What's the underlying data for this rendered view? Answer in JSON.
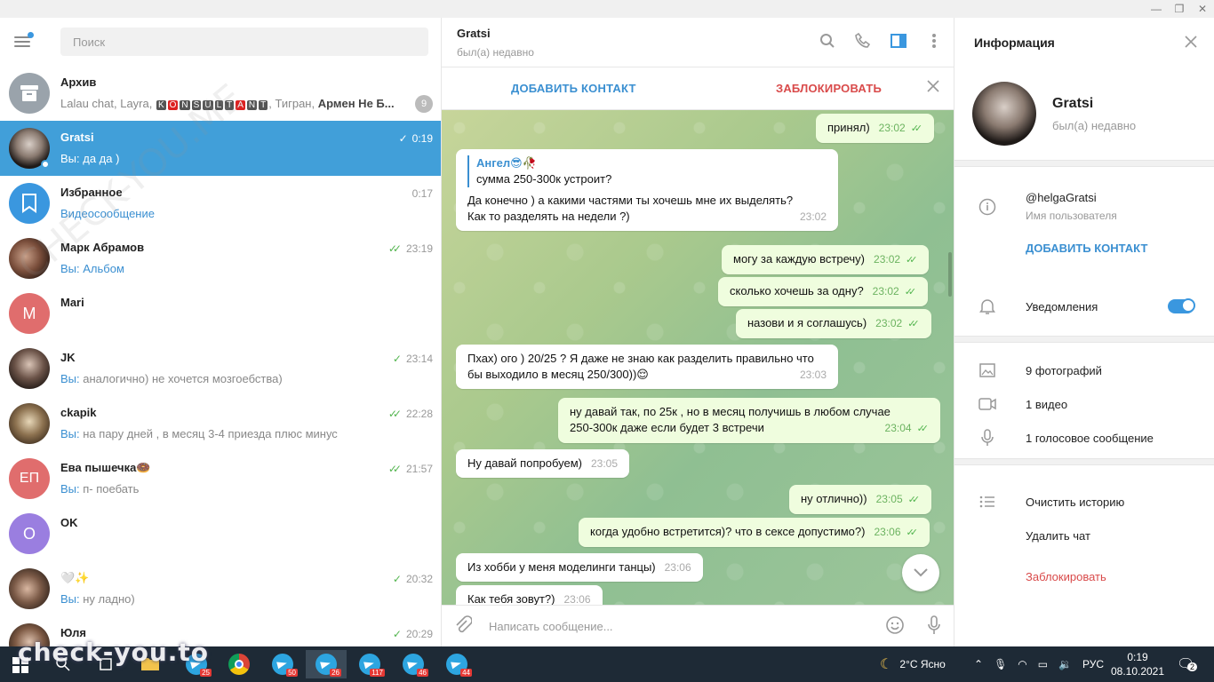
{
  "window": {
    "min": "—",
    "max": "❐",
    "close": "✕"
  },
  "left": {
    "search_placeholder": "Поиск",
    "chats": [
      {
        "name": "Архив",
        "preview": "Lalau chat, Layra, ",
        "preview_tail": ", Тигран, ",
        "preview_bold": "Армен Не Б...",
        "badge": "9",
        "konsult": [
          "K",
          "O",
          "N",
          "S",
          "U",
          "L",
          "T",
          "A",
          "N",
          "T"
        ]
      },
      {
        "name": "Gratsi",
        "you": "Вы:",
        "preview": " да да )",
        "time": "0:19"
      },
      {
        "name": "Избранное",
        "preview": "Видеосообщение",
        "time": "0:17"
      },
      {
        "name": "Марк Абрамов",
        "you": "Вы:",
        "preview": " Альбом",
        "time": "23:19"
      },
      {
        "name": "Mari",
        "initials": "M"
      },
      {
        "name": "JK",
        "you": "Вы:",
        "preview": " аналогично) не хочется мозгоебства)",
        "time": "23:14"
      },
      {
        "name": "ckapik",
        "you": "Вы:",
        "preview": " на пару дней , в месяц 3-4 приезда плюс минус",
        "time": "22:28"
      },
      {
        "name": "Ева пышечка🍩",
        "initials": "ЕП",
        "you": "Вы:",
        "preview": " п- поебать",
        "time": "21:57"
      },
      {
        "name": "OK",
        "initials": "O"
      },
      {
        "name": "🤍✨",
        "you": "Вы:",
        "preview": " ну ладно)",
        "time": "20:32"
      },
      {
        "name": "Юля",
        "time": "20:29"
      }
    ]
  },
  "center": {
    "title": "Gratsi",
    "status": "был(а) недавно",
    "add_contact": "ДОБАВИТЬ КОНТАКТ",
    "block": "ЗАБЛОКИРОВАТЬ",
    "compose_placeholder": "Написать сообщение...",
    "messages": [
      {
        "text": "принял)",
        "time": "23:02"
      },
      {
        "reply_name": "Ангел😎🥀",
        "reply_text": "сумма 250-300к устроит?",
        "text1": "Да конечно ) а какими частями ты хочешь мне их выделять?",
        "text2": "Как то разделять на недели ?)",
        "time": "23:02"
      },
      {
        "text": "могу за каждую встречу)",
        "time": "23:02"
      },
      {
        "text": "сколько хочешь за одну?",
        "time": "23:02"
      },
      {
        "text": "назови и я соглашусь)",
        "time": "23:02"
      },
      {
        "text1": "Пхах) ого ) 20/25 ? Я даже не знаю как разделить правильно что",
        "text2": "бы выходило в месяц 250/300))😌",
        "time": "23:03"
      },
      {
        "text1": "ну давай так, по 25к , но в месяц получишь в любом случае",
        "text2": "250-300к даже если будет 3 встречи",
        "time": "23:04"
      },
      {
        "text": "Ну давай попробуем)",
        "time": "23:05"
      },
      {
        "text": "ну отлично))",
        "time": "23:05"
      },
      {
        "text": "когда удобно встретится)? что в сексе допустимо?)",
        "time": "23:06"
      },
      {
        "text": "Из хобби у меня моделинги танцы)",
        "time": "23:06"
      },
      {
        "text": "Как тебя зовут?)",
        "time": "23:06"
      }
    ]
  },
  "right": {
    "title": "Информация",
    "name": "Gratsi",
    "status": "был(а) недавно",
    "username": "@helgaGratsi",
    "username_label": "Имя пользователя",
    "add_contact": "ДОБАВИТЬ КОНТАКТ",
    "notifications": "Уведомления",
    "photos": "9 фотографий",
    "videos": "1 видео",
    "voice": "1 голосовое сообщение",
    "clear": "Очистить историю",
    "delete": "Удалить чат",
    "block": "Заблокировать"
  },
  "taskbar": {
    "badges": [
      "25",
      "50",
      "26",
      "117",
      "46",
      "44"
    ],
    "weather": "2°C  Ясно",
    "lang": "РУС",
    "time": "0:19",
    "date": "08.10.2021",
    "notif": "2",
    "watermark": "check-you.to"
  },
  "watermark_diag": "CHECK-YOU.ME"
}
